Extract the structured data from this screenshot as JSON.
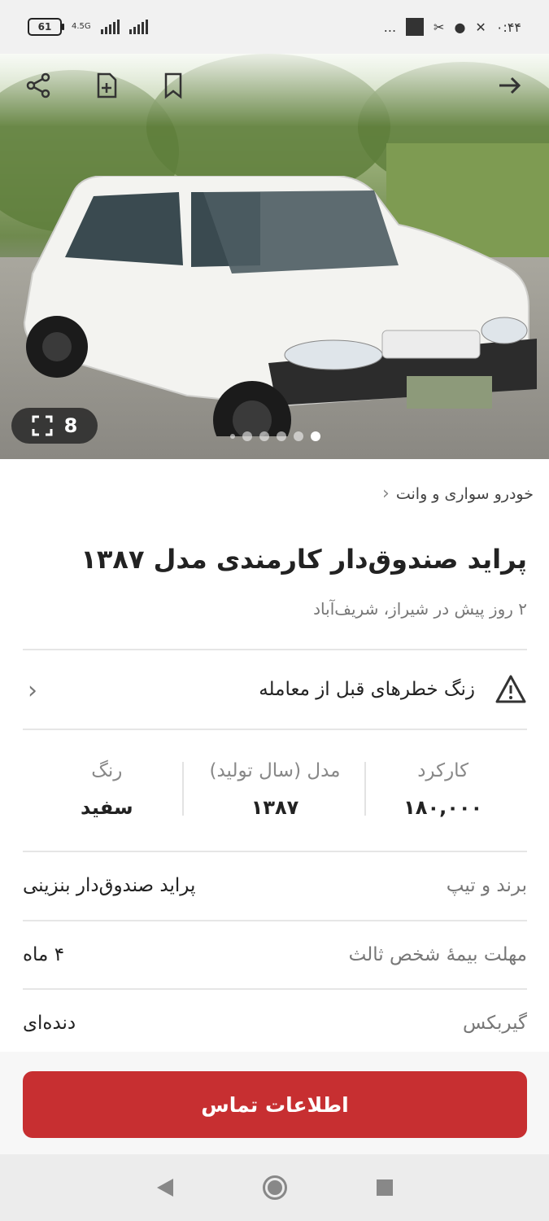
{
  "status_bar": {
    "battery": "61",
    "network": "4.5G",
    "time": "۰:۴۴",
    "more": "..."
  },
  "hero": {
    "image_count": "8",
    "dots_total": 6,
    "dots_active_index": 5
  },
  "breadcrumb": {
    "label": "خودرو سواری و وانت"
  },
  "listing": {
    "title": "پراید صندوق‌دار کارمندی مدل ۱۳۸۷",
    "subtitle": "۲ روز پیش در شیراز، شریف‌آباد"
  },
  "warning": {
    "label": "زنگ خطرهای قبل از معامله"
  },
  "stats": [
    {
      "key": "کارکرد",
      "value": "۱۸۰,۰۰۰"
    },
    {
      "key": "مدل (سال تولید)",
      "value": "۱۳۸۷"
    },
    {
      "key": "رنگ",
      "value": "سفید"
    }
  ],
  "details": [
    {
      "key": "برند و تیپ",
      "value": "پراید صندوق‌دار بنزینی"
    },
    {
      "key": "مهلت بیمهٔ شخص ثالث",
      "value": "۴ ماه"
    },
    {
      "key": "گیربکس",
      "value": "دنده‌ای"
    }
  ],
  "cta": {
    "label": "اطلاعات تماس"
  },
  "colors": {
    "cta": "#c72f31",
    "background": "#ffffff",
    "muted_text": "#777777"
  }
}
